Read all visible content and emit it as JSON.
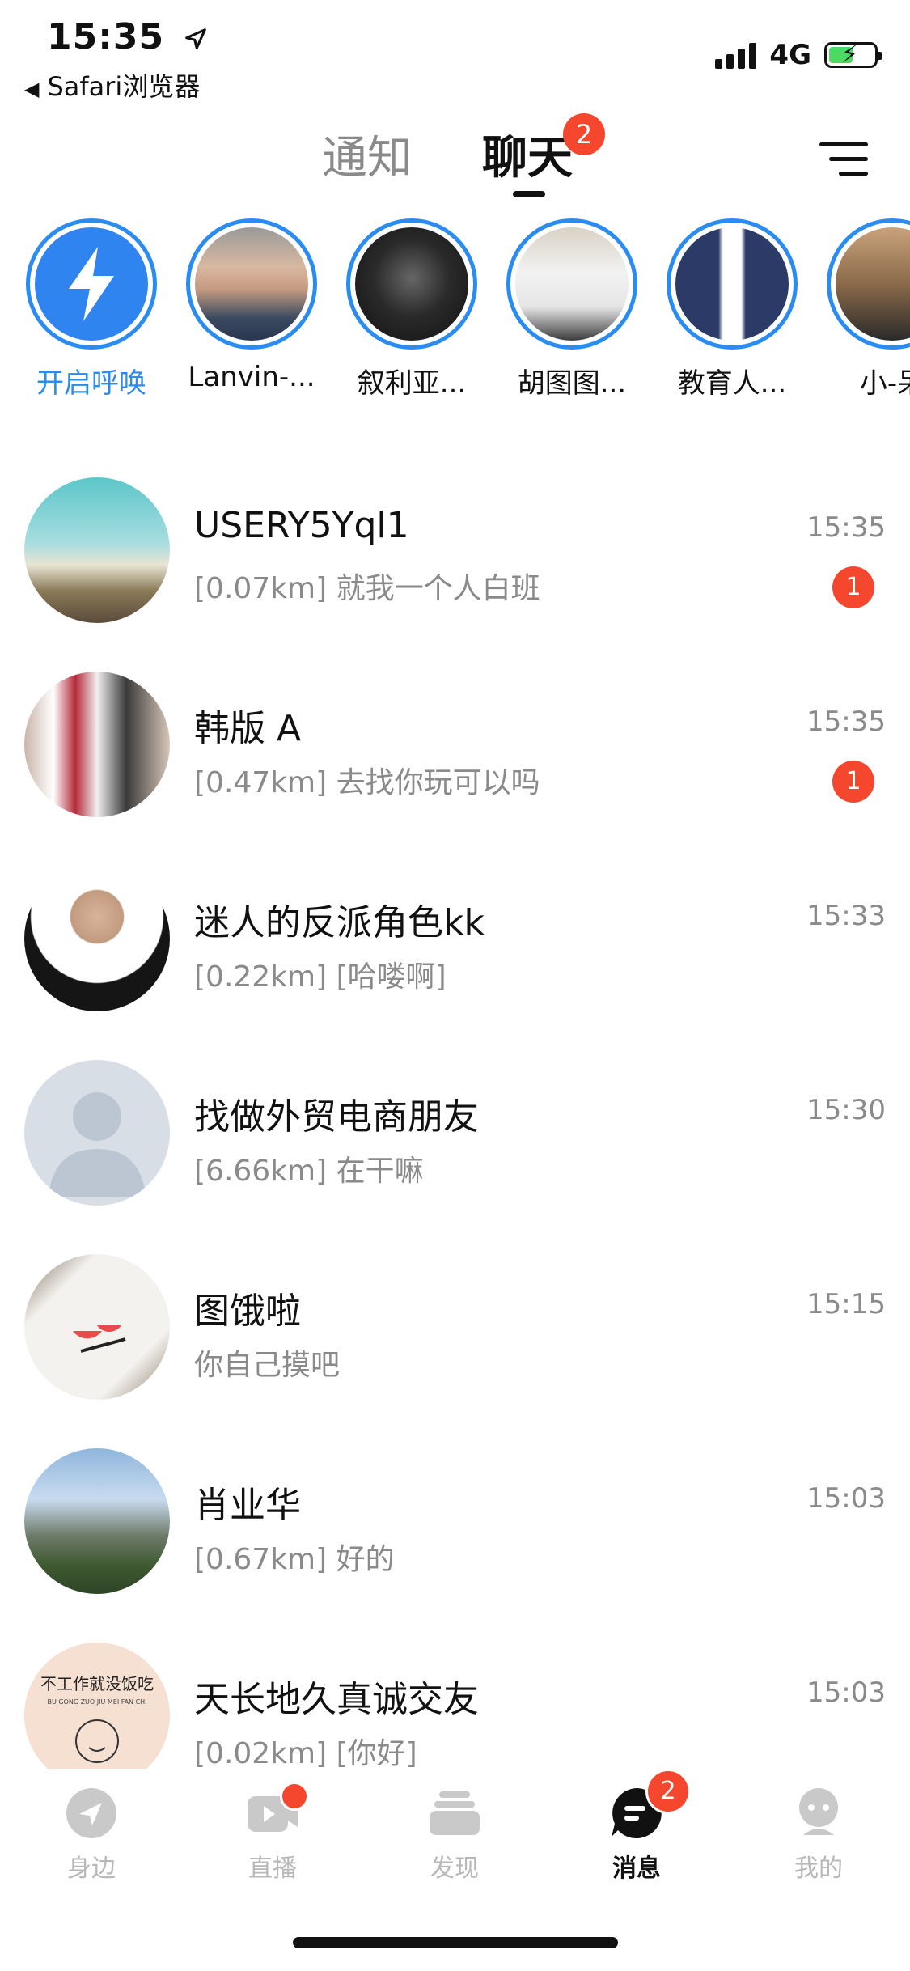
{
  "status": {
    "time": "15:35",
    "back_label": "Safari浏览器",
    "network": "4G"
  },
  "header": {
    "tab_notify": "通知",
    "tab_chat": "聊天",
    "chat_badge": "2"
  },
  "stories": [
    {
      "label": "开启呼唤"
    },
    {
      "label": "Lanvin-..."
    },
    {
      "label": "叙利亚..."
    },
    {
      "label": "胡图图..."
    },
    {
      "label": "教育人..."
    },
    {
      "label": "小-呆"
    }
  ],
  "chats": [
    {
      "name": "USERY5Yql1",
      "preview": "[0.07km] 就我一个人白班",
      "time": "15:35",
      "unread": "1"
    },
    {
      "name": "韩版 A",
      "preview": "[0.47km] 去找你玩可以吗",
      "time": "15:35",
      "unread": "1"
    },
    {
      "name": "迷人的反派角色kk",
      "preview": "[0.22km] [哈喽啊]",
      "time": "15:33",
      "unread": ""
    },
    {
      "name": "找做外贸电商朋友",
      "preview": "[6.66km] 在干嘛",
      "time": "15:30",
      "unread": ""
    },
    {
      "name": "图饿啦",
      "preview": "你自己摸吧",
      "time": "15:15",
      "unread": ""
    },
    {
      "name": "肖业华",
      "preview": "[0.67km] 好的",
      "time": "15:03",
      "unread": ""
    },
    {
      "name": "天长地久真诚交友",
      "preview": "[0.02km] [你好]",
      "time": "15:03",
      "unread": ""
    }
  ],
  "avatar_text": {
    "chat7_top": "不工作就没饭吃",
    "chat7_sub": "BU GONG ZUO JIU MEI FAN CHI"
  },
  "nav": [
    {
      "label": "身边"
    },
    {
      "label": "直播"
    },
    {
      "label": "发现"
    },
    {
      "label": "消息",
      "badge": "2"
    },
    {
      "label": "我的"
    }
  ],
  "colors": {
    "accent": "#2a8cf0",
    "badge": "#f5462e",
    "inactive": "#b8b8b8"
  }
}
